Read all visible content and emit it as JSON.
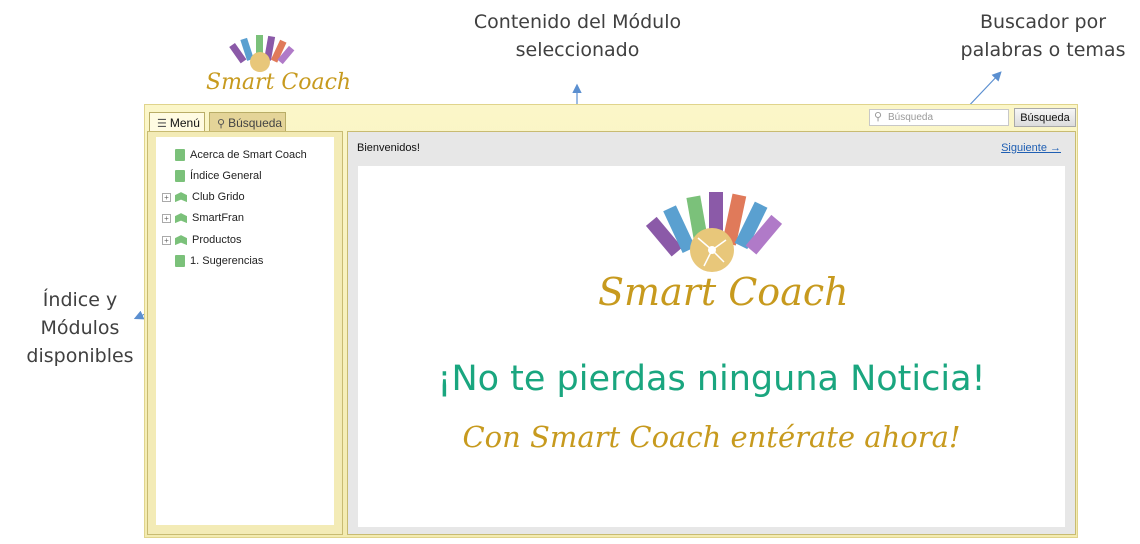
{
  "annotations": {
    "content": "Contenido del Módulo seleccionado",
    "search": "Buscador por palabras o temas",
    "index": "Índice y Módulos disponibles"
  },
  "brand": {
    "name": "Smart Coach",
    "gold": "#c79a1e",
    "green": "#1aa67f"
  },
  "tabs": [
    {
      "label": "Menú",
      "icon": "list-icon",
      "active": true
    },
    {
      "label": "Búsqueda",
      "icon": "search-icon",
      "active": false
    }
  ],
  "search": {
    "placeholder": "Búsqueda",
    "button_label": "Búsqueda"
  },
  "tree": {
    "items": [
      {
        "label": "Acerca de Smart Coach",
        "icon": "document-icon",
        "expandable": false
      },
      {
        "label": "Índice General",
        "icon": "document-icon",
        "expandable": false
      },
      {
        "label": "Club Grido",
        "icon": "book-icon",
        "expandable": true
      },
      {
        "label": "SmartFran",
        "icon": "book-icon",
        "expandable": true
      },
      {
        "label": "Productos",
        "icon": "book-icon",
        "expandable": true
      },
      {
        "label": "1. Sugerencias",
        "icon": "document-icon",
        "expandable": false
      }
    ]
  },
  "content": {
    "title": "Bienvenidos!",
    "next_label": "Siguiente →",
    "headline": "¡No te pierdas ninguna Noticia!",
    "tagline": "Con Smart Coach entérate ahora!"
  }
}
